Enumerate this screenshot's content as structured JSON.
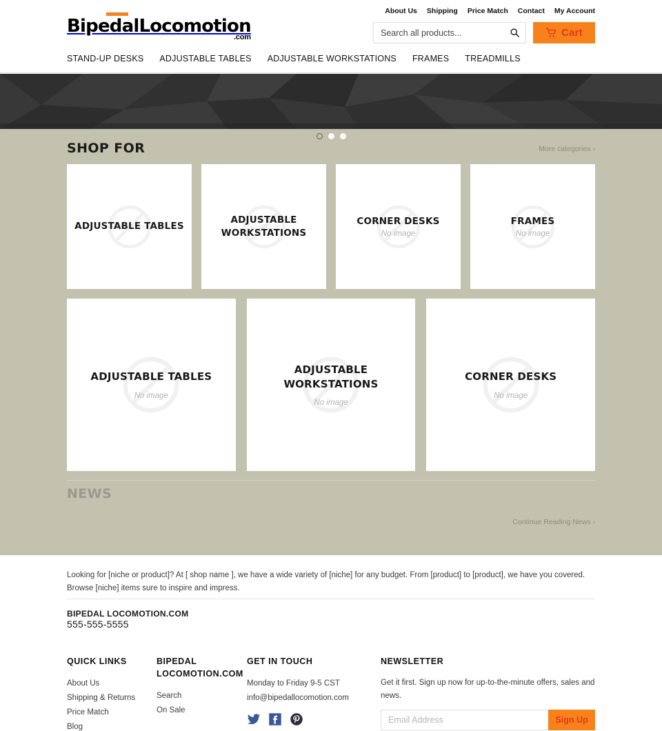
{
  "header": {
    "logo": {
      "text": "BipedalLocomotion",
      "suffix": ".com",
      "accent_color": "#f58220"
    },
    "top_links": [
      {
        "label": "About Us"
      },
      {
        "label": "Shipping"
      },
      {
        "label": "Price Match"
      },
      {
        "label": "Contact"
      },
      {
        "label": "My Account"
      }
    ],
    "search": {
      "placeholder": "Search all products...",
      "value": "",
      "icon": "search-icon"
    },
    "cart": {
      "label": "Cart",
      "icon": "shopping-cart-icon",
      "bg_color": "#f7821b",
      "text_color": "#e03a1d"
    },
    "nav": [
      {
        "label": "STAND-UP DESKS"
      },
      {
        "label": "ADJUSTABLE TABLES"
      },
      {
        "label": "ADJUSTABLE WORKSTATIONS"
      },
      {
        "label": "FRAMES"
      },
      {
        "label": "TREADMILLS"
      }
    ]
  },
  "hero": {
    "background_color": "#333333",
    "carousel_dots": [
      {
        "state": "active"
      },
      {
        "state": "inactive"
      },
      {
        "state": "inactive"
      }
    ]
  },
  "shop_for": {
    "title": "SHOP FOR",
    "more_link": "More categories ›",
    "no_image_label": "No image",
    "row1": [
      {
        "title": "ADJUSTABLE TABLES",
        "overlap": true
      },
      {
        "title": "ADJUSTABLE WORKSTATIONS",
        "overlap": true
      },
      {
        "title": "CORNER DESKS",
        "overlap": false
      },
      {
        "title": "FRAMES",
        "overlap": false
      }
    ],
    "row2": [
      {
        "title": "ADJUSTABLE TABLES"
      },
      {
        "title": "ADJUSTABLE WORKSTATIONS"
      },
      {
        "title": "CORNER DESKS"
      }
    ]
  },
  "news": {
    "title": "NEWS",
    "more_link": "Continue Reading News ›"
  },
  "footer": {
    "blurb": "Looking for [niche or product]? At [ shop name ], we have a wide variety of [niche] for any budget. From [product] to [product], we have you covered. Browse [niche] items sure to inspire and impress.",
    "shop_name": "BIPEDAL LOCOMOTION.COM",
    "phone": "555-555-5555",
    "quick_links": {
      "heading": "QUICK LINKS",
      "items": [
        {
          "label": "About Us"
        },
        {
          "label": "Shipping & Returns"
        },
        {
          "label": "Price Match"
        },
        {
          "label": "Blog"
        }
      ]
    },
    "shop_col": {
      "heading": "BIPEDAL LOCOMOTION.COM",
      "items": [
        {
          "label": "Search"
        },
        {
          "label": "On Sale"
        }
      ]
    },
    "get_in_touch": {
      "heading": "GET IN TOUCH",
      "hours": "Monday to Friday 9-5 CST",
      "email": "info@bipedallocomotion.com",
      "socials": [
        {
          "name": "twitter-icon",
          "color": "#3b5998"
        },
        {
          "name": "facebook-icon",
          "color": "#3b5998"
        },
        {
          "name": "pinterest-icon",
          "color": "#2c2c3c"
        }
      ]
    },
    "newsletter": {
      "heading": "NEWSLETTER",
      "blurb": "Get it first. Sign up now for up-to-the-minute offers, sales and news.",
      "placeholder": "Email Address",
      "value": "",
      "button_label": "Sign Up",
      "button_bg": "#f7821b",
      "button_text_color": "#e03a1d"
    }
  }
}
